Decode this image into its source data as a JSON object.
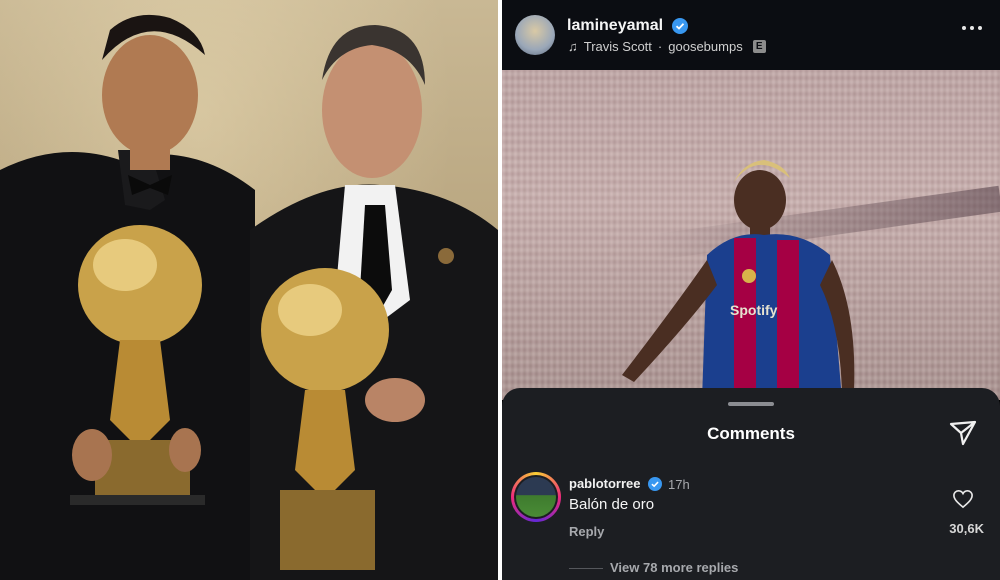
{
  "left_photo": {
    "description_icon": "trophy-photo"
  },
  "story": {
    "username": "lamineyamal",
    "music_artist": "Travis Scott",
    "music_separator": "·",
    "music_track": "goosebumps",
    "explicit_badge": "E",
    "kit_text": "Spotify"
  },
  "comments": {
    "title": "Comments",
    "items": [
      {
        "user": "pablotorree",
        "time": "17h",
        "text": "Balón de oro",
        "reply_label": "Reply",
        "like_count": "30,6K",
        "view_more": "View 78 more replies"
      }
    ]
  },
  "colors": {
    "sheet_bg": "#1c1e22",
    "header_bg": "#0b0d12",
    "verified": "#3897f0",
    "barca_blue": "#1b3f8e",
    "barca_red": "#a50044",
    "gold": "#c9a24a"
  }
}
